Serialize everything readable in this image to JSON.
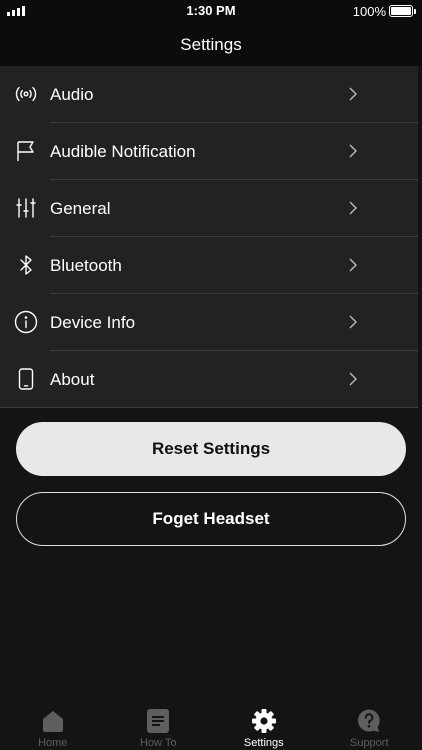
{
  "status_bar": {
    "time": "1:30 PM",
    "battery_text": "100%",
    "battery_level": 1.0
  },
  "nav": {
    "title": "Settings"
  },
  "settings_items": [
    {
      "label": "Audio",
      "icon": "audio-broadcast-icon"
    },
    {
      "label": "Audible Notification",
      "icon": "flag-icon"
    },
    {
      "label": "General",
      "icon": "sliders-icon"
    },
    {
      "label": "Bluetooth",
      "icon": "bluetooth-icon"
    },
    {
      "label": "Device Info",
      "icon": "info-icon"
    },
    {
      "label": "About",
      "icon": "phone-icon"
    }
  ],
  "buttons": {
    "reset_label": "Reset Settings",
    "forget_label": "Foget Headset"
  },
  "tabs": [
    {
      "label": "Home",
      "icon": "home-icon",
      "active": false
    },
    {
      "label": "How To",
      "icon": "document-icon",
      "active": false
    },
    {
      "label": "Settings",
      "icon": "gear-icon",
      "active": true
    },
    {
      "label": "Support",
      "icon": "question-bubble-icon",
      "active": false
    }
  ],
  "colors": {
    "background": "#141414",
    "list_background": "#222222",
    "separator": "#3c3c3c",
    "primary_button": "#e8e8e8",
    "tab_inactive": "#5e5e5e",
    "tab_active": "#ffffff"
  }
}
